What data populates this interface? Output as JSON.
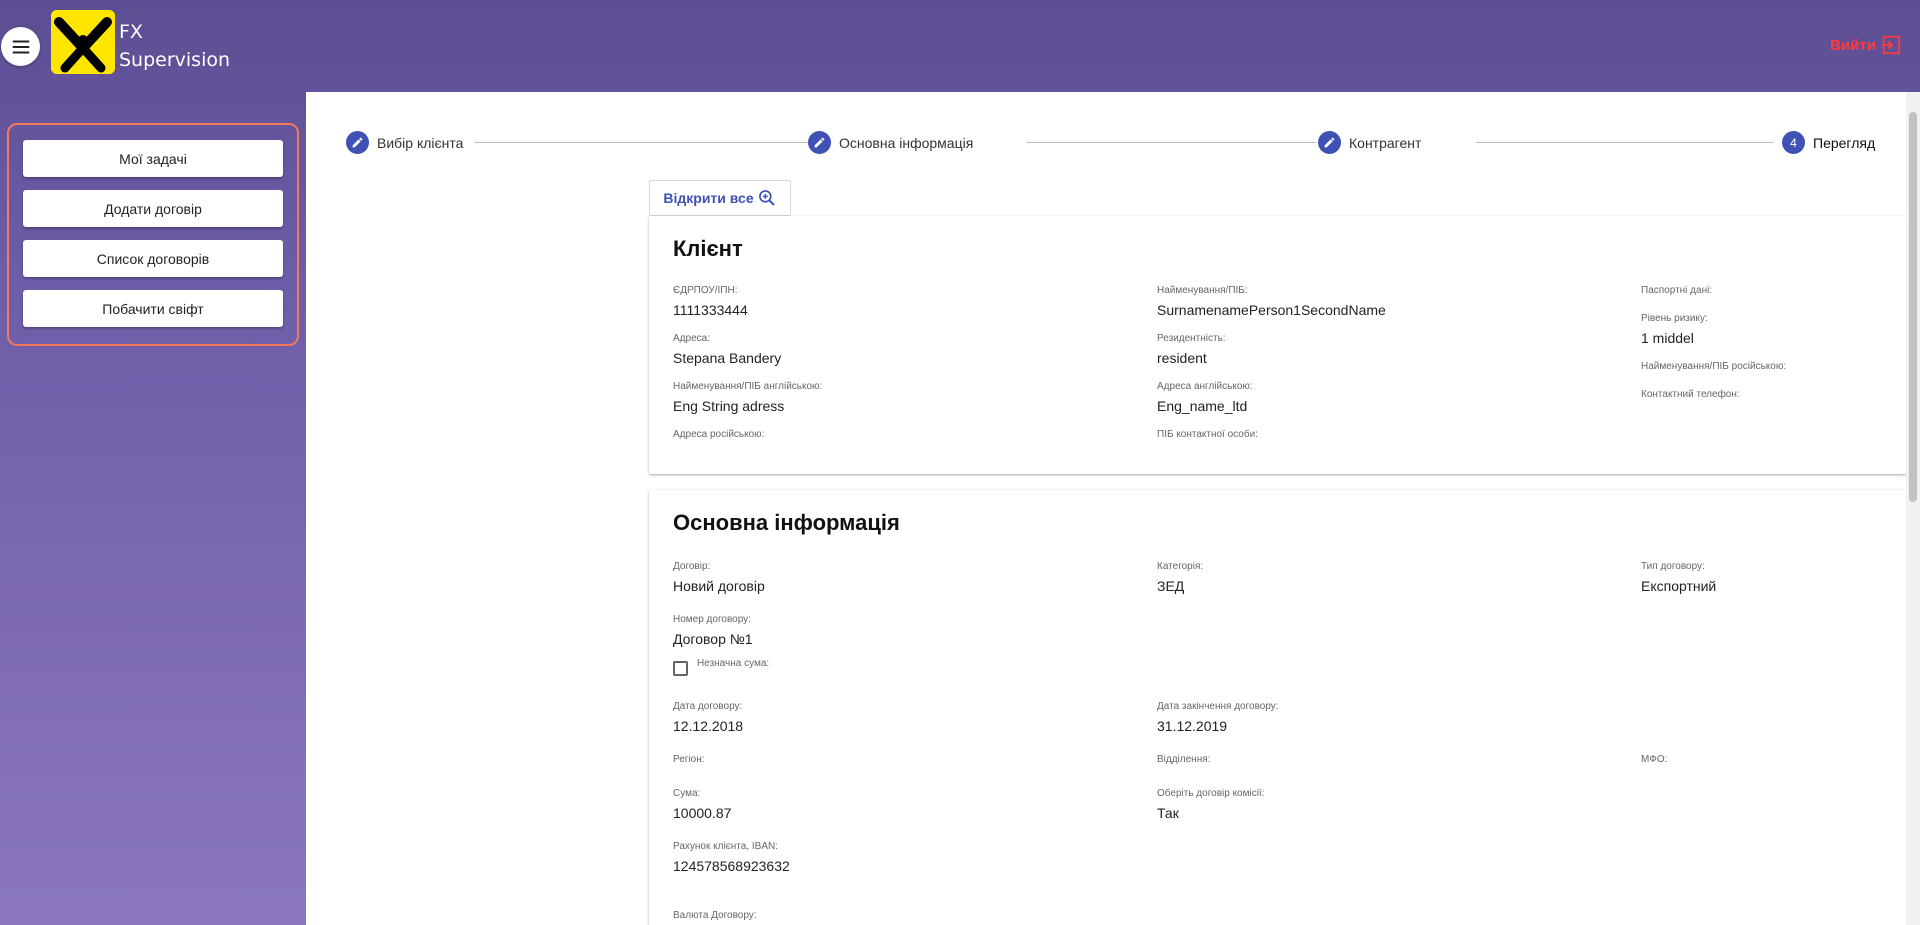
{
  "header": {
    "brand_line1": "FX",
    "brand_line2": "Supervision",
    "logout_label": "Вийти",
    "menu_icon": "hamburger-icon",
    "logout_icon": "exit-icon"
  },
  "sidebar": {
    "items": [
      {
        "label": "Мої задачі"
      },
      {
        "label": "Додати договір"
      },
      {
        "label": "Список договорів"
      },
      {
        "label": "Побачити свіфт"
      }
    ]
  },
  "stepper": {
    "steps": [
      {
        "label": "Вибір клієнта",
        "state": "edit"
      },
      {
        "label": "Основна інформація",
        "state": "edit"
      },
      {
        "label": "Контрагент",
        "state": "edit"
      },
      {
        "label": "Перегляд",
        "state": "active",
        "number": "4"
      }
    ]
  },
  "open_all_label": "Відкрити все",
  "client": {
    "title": "Клієнт",
    "fields": [
      {
        "label": "ЄДРПОУ/ІПН:",
        "value": "1111333444"
      },
      {
        "label": "Найменування/ПІБ:",
        "value": "SurnamenamePerson1SecondName"
      },
      {
        "label": "Паспортні дані:",
        "value": ""
      },
      {
        "label": "Рівень ризику:",
        "value": "1 middel"
      },
      {
        "label": "Адреса:",
        "value": "Stepana Bandery"
      },
      {
        "label": "Резидентність:",
        "value": "resident"
      },
      {
        "label": "Найменування/ПІБ російською:",
        "value": ""
      },
      {
        "label": "Найменування/ПІБ англійською:",
        "value": "Eng String adress"
      },
      {
        "label": "Адреса англійською:",
        "value": "Eng_name_ltd"
      },
      {
        "label": "Контактний телефон:",
        "value": ""
      },
      {
        "label": "Адреса російською:",
        "value": ""
      },
      {
        "label": "ПІБ контактної особи:",
        "value": ""
      }
    ]
  },
  "main_info": {
    "title": "Основна інформація",
    "fields": [
      {
        "label": "Договір:",
        "value": "Новий договір"
      },
      {
        "label": "Категорія:",
        "value": "ЗЕД"
      },
      {
        "label": "Тип договору:",
        "value": "Експортний"
      },
      {
        "label": "Номер договору:",
        "value": "Договор №1"
      },
      {
        "label": "Незначна сума:",
        "value": ""
      },
      {
        "label": "Дата договору:",
        "value": "12.12.2018"
      },
      {
        "label": "Дата закінчення договору:",
        "value": "31.12.2019"
      },
      {
        "label": "Регіон:",
        "value": ""
      },
      {
        "label": "Відділення:",
        "value": ""
      },
      {
        "label": "МФО:",
        "value": ""
      },
      {
        "label": "Сума:",
        "value": "10000.87"
      },
      {
        "label": "Оберіть договір комісії:",
        "value": "Так"
      },
      {
        "label": "Рахунок клієнта, IBAN:",
        "value": "124578568923632"
      },
      {
        "label": "Валюта Договору:",
        "value": ""
      }
    ]
  },
  "colors": {
    "accent": "#3f51b5",
    "logout": "#ff3a3a",
    "sidebar_border": "#f07a5a",
    "logo_bg": "#ffe600"
  }
}
